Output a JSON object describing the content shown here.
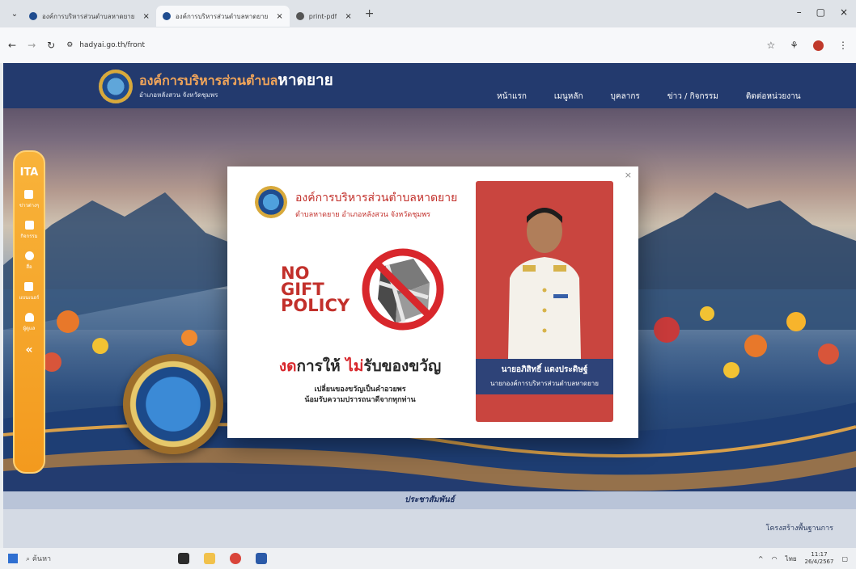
{
  "browser": {
    "tabs": [
      {
        "title": "องค์การบริหารส่วนตำบลหาดยาย",
        "active": false
      },
      {
        "title": "องค์การบริหารส่วนตำบลหาดยาย",
        "active": true
      },
      {
        "title": "print-pdf",
        "active": false
      }
    ],
    "url": "hadyai.go.th/front"
  },
  "site": {
    "name_prefix": "องค์การบริหารส่วนตำบล",
    "name_main": "หาดยาย",
    "subtitle": "อำเภอหลังสวน จังหวัดชุมพร",
    "nav": [
      "หน้าแรก",
      "เมนูหลัก",
      "บุคลากร",
      "ข่าว / กิจกรรม",
      "ติดต่อหน่วยงาน"
    ],
    "sidebar": {
      "logo": "ITA",
      "items": [
        "ข่าวต่างๆ",
        "กิจกรรม",
        "สื่อ",
        "แบนเนอร์",
        "ผู้ดูแล"
      ],
      "collapse": "«"
    },
    "pr_bar": "ประชาสัมพันธ์",
    "pr_link": "โครงสร้างพื้นฐานการ"
  },
  "modal": {
    "close": "×",
    "org": "องค์การบริหารส่วนตำบลหาดยาย",
    "address": "ตำบลหาดยาย อำเภอหลังสวน จังหวัดชุมพร",
    "policy_lines": [
      "NO",
      "GIFT",
      "POLICY"
    ],
    "slogan_a": "งด",
    "slogan_b": "การให้ ",
    "slogan_c": "ไม่",
    "slogan_d": "รับของขวัญ",
    "sub1": "เปลี่ยนของขวัญเป็นคำอวยพร",
    "sub2": "น้อมรับความปรารถนาดีจากทุกท่าน",
    "person_name": "นายอภิสิทธิ์ แดงประดิษฐ์",
    "person_title": "นายกองค์การบริหารส่วนตำบลหาดยาย"
  },
  "taskbar": {
    "search": "ค้นหา",
    "clock_time": "11:17",
    "clock_date": "26/4/2567",
    "lang": "ไทย"
  },
  "colors": {
    "header": "#233a6e",
    "accent_orange": "#f39a1e",
    "policy_red": "#c2302b",
    "portrait_bg": "#c9453f"
  }
}
